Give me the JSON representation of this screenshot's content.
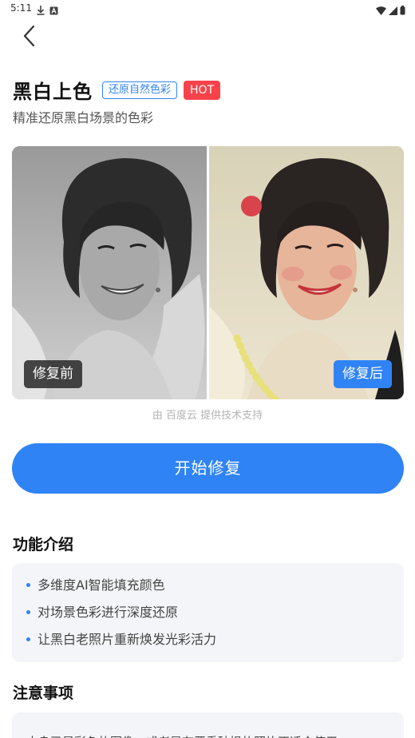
{
  "status_bar": {
    "time": "5:11"
  },
  "header": {
    "title": "黑白上色",
    "tag": "还原自然色彩",
    "hot_badge": "HOT",
    "subtitle": "精准还原黑白场景的色彩"
  },
  "compare": {
    "before_label": "修复前",
    "after_label": "修复后"
  },
  "provider_text": "由 百度云 提供技术支持",
  "start_button": "开始修复",
  "features": {
    "title": "功能介绍",
    "items": [
      "多维度AI智能填充颜色",
      "对场景色彩进行深度还原",
      "让黑白老照片重新焕发光彩活力"
    ]
  },
  "notes": {
    "title": "注意事项",
    "text": "本身已是彩色的图像，或者是有严重破损的照片不适合使用"
  }
}
